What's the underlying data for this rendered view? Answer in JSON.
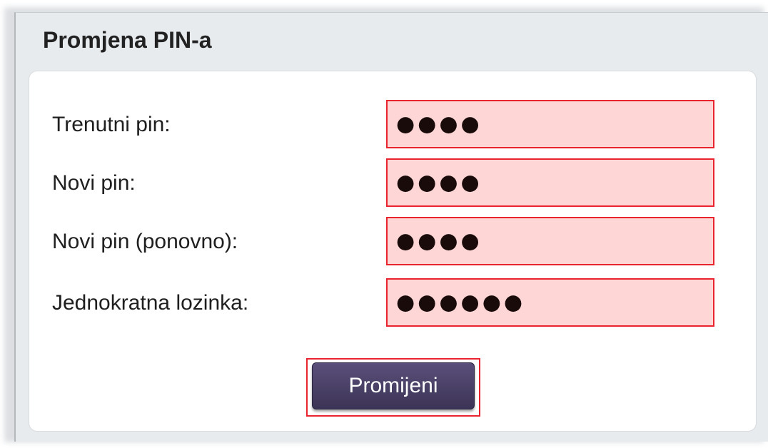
{
  "panel": {
    "title": "Promjena PIN-a"
  },
  "form": {
    "fields": [
      {
        "label": "Trenutni pin:",
        "masked_value": "●●●●"
      },
      {
        "label": "Novi pin:",
        "masked_value": "●●●●"
      },
      {
        "label": "Novi pin (ponovno):",
        "masked_value": "●●●●"
      },
      {
        "label": "Jednokratna lozinka:",
        "masked_value": "●●●●●●"
      }
    ],
    "submit_label": "Promijeni"
  },
  "colors": {
    "panel_background": "#e8ebee",
    "field_background": "#ffd6d6",
    "highlight_border": "#e8242c",
    "button_background": "#4a4068",
    "button_text": "#ffffff"
  }
}
